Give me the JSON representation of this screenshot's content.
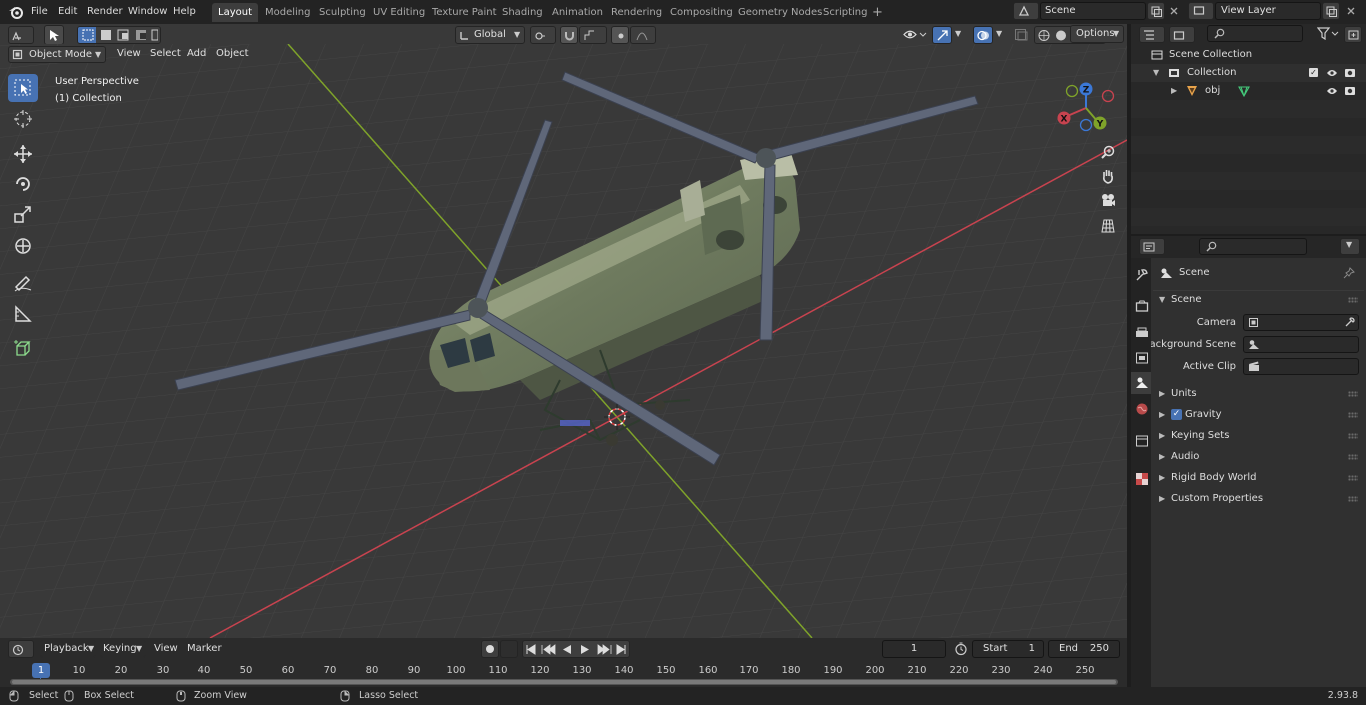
{
  "menus": [
    "File",
    "Edit",
    "Render",
    "Window",
    "Help"
  ],
  "workspace_tabs": [
    "Layout",
    "Modeling",
    "Sculpting",
    "UV Editing",
    "Texture Paint",
    "Shading",
    "Animation",
    "Rendering",
    "Compositing",
    "Geometry Nodes",
    "Scripting"
  ],
  "active_workspace": "Layout",
  "add_workspace": "+",
  "scene_field": "Scene",
  "view_layer_field": "View Layer",
  "viewport_header": {
    "mode": "Object Mode",
    "menus": [
      "View",
      "Select",
      "Add",
      "Object"
    ],
    "orientation": "Global",
    "options": "Options"
  },
  "viewport_overlay": {
    "perspective": "User Perspective",
    "collection": "(1) Collection"
  },
  "gizmo": {
    "z": "Z",
    "x": "X",
    "y": "Y"
  },
  "outliner": {
    "items": [
      "Scene Collection",
      "Collection",
      "obj"
    ]
  },
  "properties": {
    "header": "Scene",
    "panel": "Scene",
    "fields": [
      {
        "label": "Camera"
      },
      {
        "label": "Background Scene"
      },
      {
        "label": "Active Clip"
      }
    ],
    "subpanels": [
      "Units",
      "Gravity",
      "Keying Sets",
      "Audio",
      "Rigid Body World",
      "Custom Properties"
    ]
  },
  "timeline_header": {
    "menus": [
      "Playback",
      "Keying",
      "View",
      "Marker"
    ],
    "current_frame": "1",
    "start_label": "Start",
    "start_value": "1",
    "end_label": "End",
    "end_value": "250"
  },
  "timeline_ticks": [
    "1",
    "10",
    "20",
    "30",
    "40",
    "50",
    "60",
    "70",
    "80",
    "90",
    "100",
    "110",
    "120",
    "130",
    "140",
    "150",
    "160",
    "170",
    "180",
    "190",
    "200",
    "210",
    "220",
    "230",
    "240",
    "250"
  ],
  "statusbar": {
    "select": "Select",
    "box_select": "Box Select",
    "zoom_view": "Zoom View",
    "lasso_select": "Lasso Select",
    "version": "2.93.8"
  },
  "colors": {
    "accent": "#4772b3",
    "x_axis": "#c8434f",
    "y_axis": "#7fa32a",
    "z_axis": "#3b78d6",
    "grid": "#4a4a4a",
    "viewport_bg": "#393939"
  }
}
